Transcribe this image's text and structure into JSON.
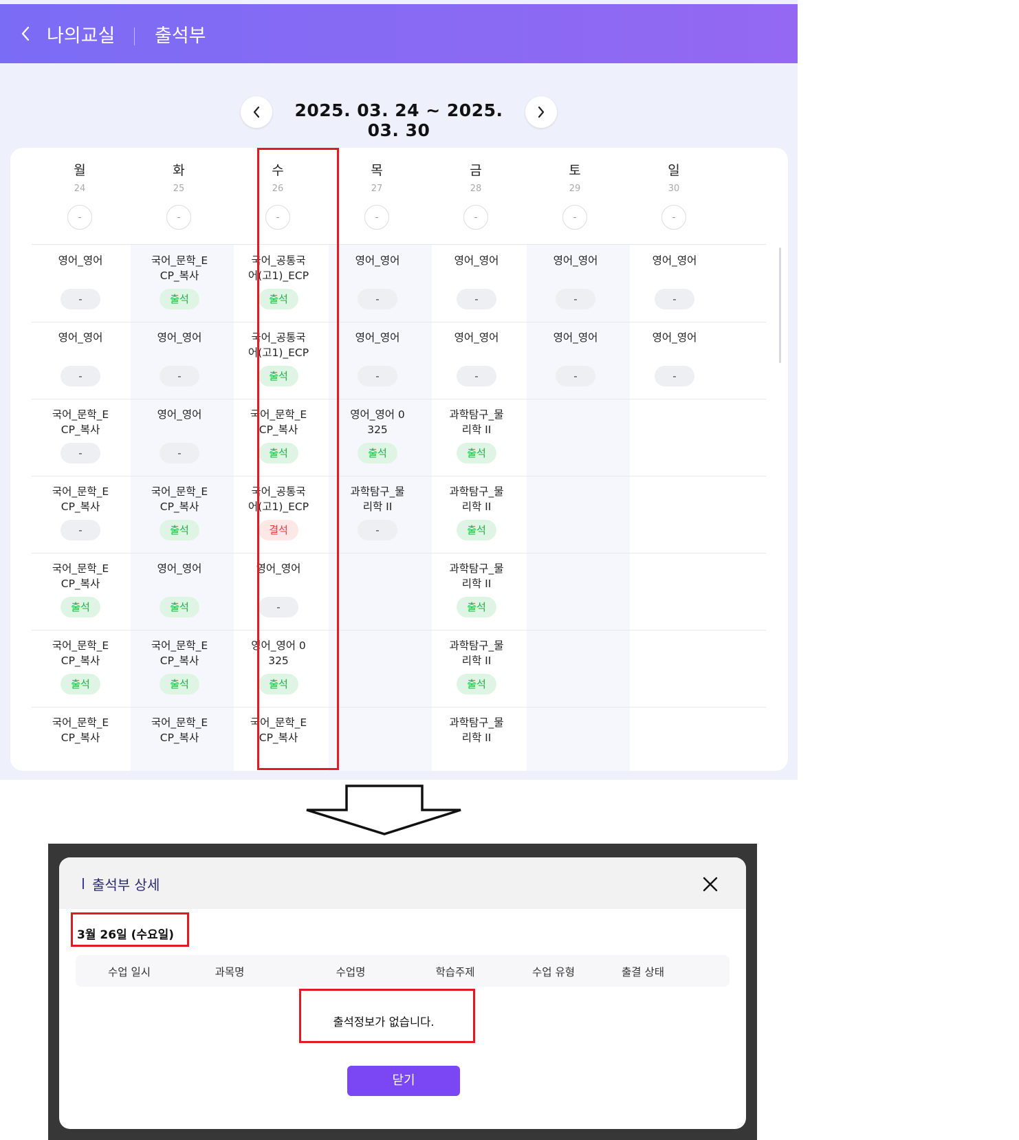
{
  "header": {
    "title": "나의교실",
    "subtitle": "출석부"
  },
  "week": {
    "range": "2025. 03. 24 ~ 2025. 03. 30"
  },
  "days": [
    {
      "name": "월",
      "date": "24",
      "count": "-"
    },
    {
      "name": "화",
      "date": "25",
      "count": "-"
    },
    {
      "name": "수",
      "date": "26",
      "count": "-"
    },
    {
      "name": "목",
      "date": "27",
      "count": "-"
    },
    {
      "name": "금",
      "date": "28",
      "count": "-"
    },
    {
      "name": "토",
      "date": "29",
      "count": "-"
    },
    {
      "name": "일",
      "date": "30",
      "count": "-"
    }
  ],
  "rows": [
    [
      {
        "name": "영어_영어",
        "status": "-"
      },
      {
        "name": "국어_문학_E\nCP_복사",
        "status": "출석"
      },
      {
        "name": "국어_공통국\n어(고1)_ECP",
        "status": "출석"
      },
      {
        "name": "영어_영어",
        "status": "-"
      },
      {
        "name": "영어_영어",
        "status": "-"
      },
      {
        "name": "영어_영어",
        "status": "-"
      },
      {
        "name": "영어_영어",
        "status": "-"
      }
    ],
    [
      {
        "name": "영어_영어",
        "status": "-"
      },
      {
        "name": "영어_영어",
        "status": "-"
      },
      {
        "name": "국어_공통국\n어(고1)_ECP",
        "status": "출석"
      },
      {
        "name": "영어_영어",
        "status": "-"
      },
      {
        "name": "영어_영어",
        "status": "-"
      },
      {
        "name": "영어_영어",
        "status": "-"
      },
      {
        "name": "영어_영어",
        "status": "-"
      }
    ],
    [
      {
        "name": "국어_문학_E\nCP_복사",
        "status": "-"
      },
      {
        "name": "영어_영어",
        "status": "-"
      },
      {
        "name": "국어_문학_E\nCP_복사",
        "status": "출석"
      },
      {
        "name": "영어_영어 0\n325",
        "status": "출석"
      },
      {
        "name": "과학탐구_물\n리학 II",
        "status": "출석"
      },
      null,
      null
    ],
    [
      {
        "name": "국어_문학_E\nCP_복사",
        "status": "-"
      },
      {
        "name": "국어_문학_E\nCP_복사",
        "status": "출석"
      },
      {
        "name": "국어_공통국\n어(고1)_ECP",
        "status": "결석"
      },
      {
        "name": "과학탐구_물\n리학 II",
        "status": "-"
      },
      {
        "name": "과학탐구_물\n리학 II",
        "status": "출석"
      },
      null,
      null
    ],
    [
      {
        "name": "국어_문학_E\nCP_복사",
        "status": "출석"
      },
      {
        "name": "영어_영어",
        "status": "출석"
      },
      {
        "name": "영어_영어",
        "status": "-"
      },
      null,
      {
        "name": "과학탐구_물\n리학 II",
        "status": "출석"
      },
      null,
      null
    ],
    [
      {
        "name": "국어_문학_E\nCP_복사",
        "status": "출석"
      },
      {
        "name": "국어_문학_E\nCP_복사",
        "status": "출석"
      },
      {
        "name": "영어_영어 0\n325",
        "status": "출석"
      },
      null,
      {
        "name": "과학탐구_물\n리학 II",
        "status": "출석"
      },
      null,
      null
    ],
    [
      {
        "name": "국어_문학_E\nCP_복사",
        "status": ""
      },
      {
        "name": "국어_문학_E\nCP_복사",
        "status": ""
      },
      {
        "name": "국어_문학_E\nCP_복사",
        "status": ""
      },
      null,
      {
        "name": "과학탐구_물\n리학 II",
        "status": ""
      },
      null,
      null
    ]
  ],
  "modal": {
    "title": "출석부 상세",
    "date": "3월 26일 (수요일)",
    "columns": [
      "수업 일시",
      "과목명",
      "수업명",
      "학습주제",
      "수업 유형",
      "출결 상태"
    ],
    "empty_message": "출석정보가 없습니다.",
    "close_label": "닫기"
  },
  "colors": {
    "header_gradient_start": "#7b6cf5",
    "header_gradient_end": "#9468f2",
    "present": "#21b345",
    "absent": "#e53b3b",
    "highlight": "#e21b22",
    "primary_button": "#7b47f5"
  },
  "icons": {
    "back": "chevron-left-icon",
    "prev": "chevron-left-icon",
    "next": "chevron-right-icon",
    "close": "close-icon",
    "arrow": "down-arrow-icon"
  }
}
